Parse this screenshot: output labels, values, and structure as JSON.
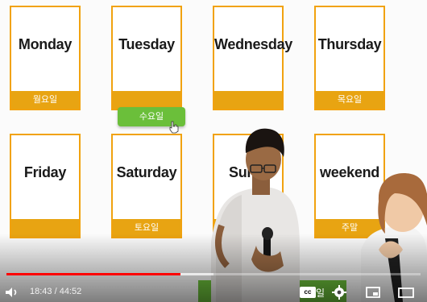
{
  "cards": [
    {
      "word": "Monday",
      "korean": "월요일"
    },
    {
      "word": "Tuesday",
      "korean": ""
    },
    {
      "word": "Wednesday",
      "korean": ""
    },
    {
      "word": "Thursday",
      "korean": "목요일"
    },
    {
      "word": "Friday",
      "korean": ""
    },
    {
      "word": "Saturday",
      "korean": "토요일"
    },
    {
      "word": "Sun",
      "korean": ""
    },
    {
      "word": "weekend",
      "korean": "주말"
    }
  ],
  "drag_label": "수요일",
  "partial_label": "일",
  "player": {
    "time": "18:43 / 44:52",
    "progress_fraction": 0.42,
    "cc_label": "cc",
    "icons": [
      "volume-icon",
      "closed-captions-icon",
      "settings-gear-icon",
      "miniplayer-icon",
      "theater-mode-icon"
    ]
  },
  "colors": {
    "card_border": "#f1a20f",
    "card_bar": "#e8a412",
    "drag_label": "#6bbf3a",
    "progress": "#ff0000"
  }
}
